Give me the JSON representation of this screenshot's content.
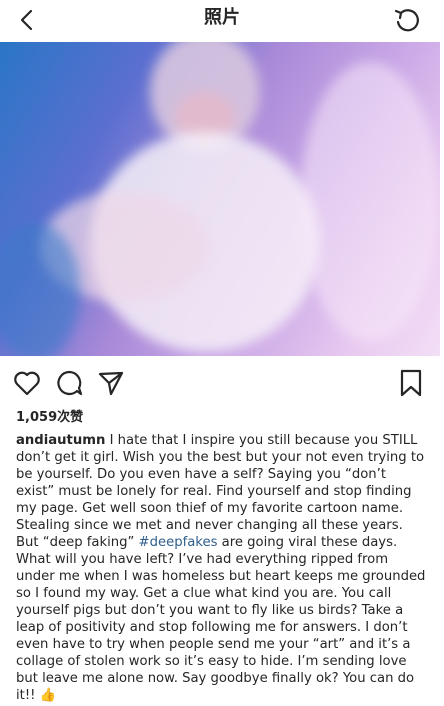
{
  "header": {
    "title": "照片"
  },
  "post": {
    "likes": "1,059次赞",
    "username": "andiautumn",
    "caption_pre": "I hate that I inspire you still because you STILL don’t get it girl. Wish you the best but your not even trying to be yourself. Do you even have a self? Saying you “don’t exist” must be lonely for real. Find yourself and stop finding my page. Get well soon thief of my favorite cartoon name. Stealing since we met and never changing all these years. But “deep faking” ",
    "hashtag": "#deepfakes",
    "caption_post": " are going viral these days. What will you have left? I’ve had everything ripped from under me when I was homeless but heart keeps me grounded so I found my way. Get a clue what kind you are. You call yourself pigs but don’t you want to fly like us birds? Take a leap of positivity and stop following me for answers. I don’t even have to try when people send me your “art” and it’s a collage of stolen work so it’s easy to hide. I’m sending love but leave me alone now. Say goodbye finally ok? You can do it!! ",
    "emoji": "👍"
  },
  "icons": {
    "back": "chevron-left-icon",
    "refresh": "refresh-icon",
    "like": "heart-icon",
    "comment": "comment-icon",
    "share": "send-icon",
    "save": "bookmark-icon"
  }
}
